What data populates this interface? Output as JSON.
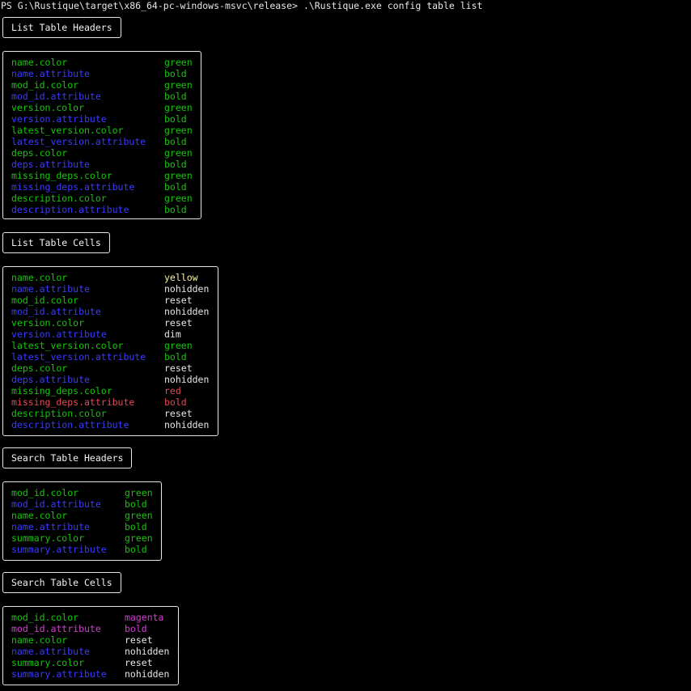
{
  "prompt": "PS G:\\Rustique\\target\\x86_64-pc-windows-msvc\\release> .\\Rustique.exe config table list",
  "sections": [
    {
      "title": "List Table Headers",
      "rows": [
        {
          "key": "name.color",
          "value": "green",
          "key_color": "green",
          "value_color": "green"
        },
        {
          "key": "name.attribute",
          "value": "bold",
          "key_color": "blue",
          "value_color": "green"
        },
        {
          "key": "mod_id.color",
          "value": "green",
          "key_color": "green",
          "value_color": "green"
        },
        {
          "key": "mod_id.attribute",
          "value": "bold",
          "key_color": "blue",
          "value_color": "green"
        },
        {
          "key": "version.color",
          "value": "green",
          "key_color": "green",
          "value_color": "green"
        },
        {
          "key": "version.attribute",
          "value": "bold",
          "key_color": "blue",
          "value_color": "green"
        },
        {
          "key": "latest_version.color",
          "value": "green",
          "key_color": "green",
          "value_color": "green"
        },
        {
          "key": "latest_version.attribute",
          "value": "bold",
          "key_color": "blue",
          "value_color": "green"
        },
        {
          "key": "deps.color",
          "value": "green",
          "key_color": "green",
          "value_color": "green"
        },
        {
          "key": "deps.attribute",
          "value": "bold",
          "key_color": "blue",
          "value_color": "green"
        },
        {
          "key": "missing_deps.color",
          "value": "green",
          "key_color": "green",
          "value_color": "green"
        },
        {
          "key": "missing_deps.attribute",
          "value": "bold",
          "key_color": "blue",
          "value_color": "green"
        },
        {
          "key": "description.color",
          "value": "green",
          "key_color": "green",
          "value_color": "green"
        },
        {
          "key": "description.attribute",
          "value": "bold",
          "key_color": "blue",
          "value_color": "green"
        }
      ]
    },
    {
      "title": "List Table Cells",
      "rows": [
        {
          "key": "name.color",
          "value": "yellow",
          "key_color": "green",
          "value_color": "yellow"
        },
        {
          "key": "name.attribute",
          "value": "nohidden",
          "key_color": "blue",
          "value_color": "white"
        },
        {
          "key": "mod_id.color",
          "value": "reset",
          "key_color": "green",
          "value_color": "white"
        },
        {
          "key": "mod_id.attribute",
          "value": "nohidden",
          "key_color": "blue",
          "value_color": "white"
        },
        {
          "key": "version.color",
          "value": "reset",
          "key_color": "green",
          "value_color": "white"
        },
        {
          "key": "version.attribute",
          "value": "dim",
          "key_color": "blue",
          "value_color": "white"
        },
        {
          "key": "latest_version.color",
          "value": "green",
          "key_color": "green",
          "value_color": "green"
        },
        {
          "key": "latest_version.attribute",
          "value": "bold",
          "key_color": "blue",
          "value_color": "green"
        },
        {
          "key": "deps.color",
          "value": "reset",
          "key_color": "green",
          "value_color": "white"
        },
        {
          "key": "deps.attribute",
          "value": "nohidden",
          "key_color": "blue",
          "value_color": "white"
        },
        {
          "key": "missing_deps.color",
          "value": "red",
          "key_color": "green",
          "value_color": "red"
        },
        {
          "key": "missing_deps.attribute",
          "value": "bold",
          "key_color": "red",
          "value_color": "red"
        },
        {
          "key": "description.color",
          "value": "reset",
          "key_color": "green",
          "value_color": "white"
        },
        {
          "key": "description.attribute",
          "value": "nohidden",
          "key_color": "blue",
          "value_color": "white"
        }
      ]
    },
    {
      "title": "Search Table Headers",
      "rows": [
        {
          "key": "mod_id.color",
          "value": "green",
          "key_color": "green",
          "value_color": "green"
        },
        {
          "key": "mod_id.attribute",
          "value": "bold",
          "key_color": "blue",
          "value_color": "green"
        },
        {
          "key": "name.color",
          "value": "green",
          "key_color": "green",
          "value_color": "green"
        },
        {
          "key": "name.attribute",
          "value": "bold",
          "key_color": "blue",
          "value_color": "green"
        },
        {
          "key": "summary.color",
          "value": "green",
          "key_color": "green",
          "value_color": "green"
        },
        {
          "key": "summary.attribute",
          "value": "bold",
          "key_color": "blue",
          "value_color": "green"
        }
      ]
    },
    {
      "title": "Search Table Cells",
      "rows": [
        {
          "key": "mod_id.color",
          "value": "magenta",
          "key_color": "green",
          "value_color": "magenta"
        },
        {
          "key": "mod_id.attribute",
          "value": "bold",
          "key_color": "magenta",
          "value_color": "magenta"
        },
        {
          "key": "name.color",
          "value": "reset",
          "key_color": "green",
          "value_color": "white"
        },
        {
          "key": "name.attribute",
          "value": "nohidden",
          "key_color": "blue",
          "value_color": "white"
        },
        {
          "key": "summary.color",
          "value": "reset",
          "key_color": "green",
          "value_color": "white"
        },
        {
          "key": "summary.attribute",
          "value": "nohidden",
          "key_color": "blue",
          "value_color": "white"
        }
      ]
    }
  ],
  "colors": {
    "background": "#000000",
    "green": "#16c60c",
    "blue": "#3b3bff",
    "yellow": "#f9f1a5",
    "white": "#e6e6e6",
    "red": "#e74856",
    "magenta": "#d63bd6"
  }
}
